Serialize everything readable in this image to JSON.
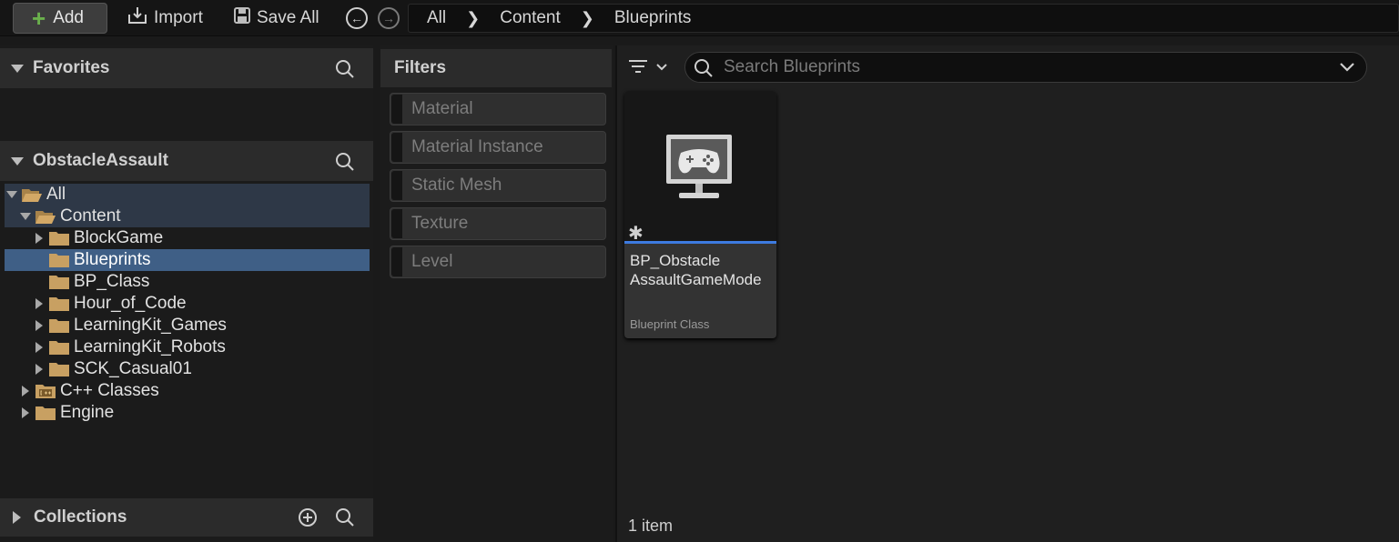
{
  "toolbar": {
    "add_label": "Add",
    "import_label": "Import",
    "save_all_label": "Save All"
  },
  "breadcrumb": [
    "All",
    "Content",
    "Blueprints"
  ],
  "left_panel": {
    "favorites_title": "Favorites",
    "project_title": "ObstacleAssault",
    "collections_title": "Collections",
    "tree": {
      "all": "All",
      "content": "Content",
      "blockgame": "BlockGame",
      "blueprints": "Blueprints",
      "bp_class": "BP_Class",
      "hour_of_code": "Hour_of_Code",
      "learningkit_games": "LearningKit_Games",
      "learningkit_robots": "LearningKit_Robots",
      "sck_casual": "SCK_Casual01",
      "cpp_classes": "C++ Classes",
      "engine": "Engine"
    }
  },
  "filters": {
    "title": "Filters",
    "items": [
      "Material",
      "Material Instance",
      "Static Mesh",
      "Texture",
      "Level"
    ]
  },
  "content": {
    "search_placeholder": "Search Blueprints",
    "asset": {
      "name_line1": "BP_Obstacle",
      "name_line2": "AssaultGameMode",
      "type": "Blueprint Class",
      "icon": "gamepad-monitor-icon"
    },
    "item_count": "1 item"
  },
  "colors": {
    "accent_blue": "#3d7be0",
    "selection": "#3f5f86",
    "add_green": "#6ab04c",
    "folder": "#c8a062"
  }
}
